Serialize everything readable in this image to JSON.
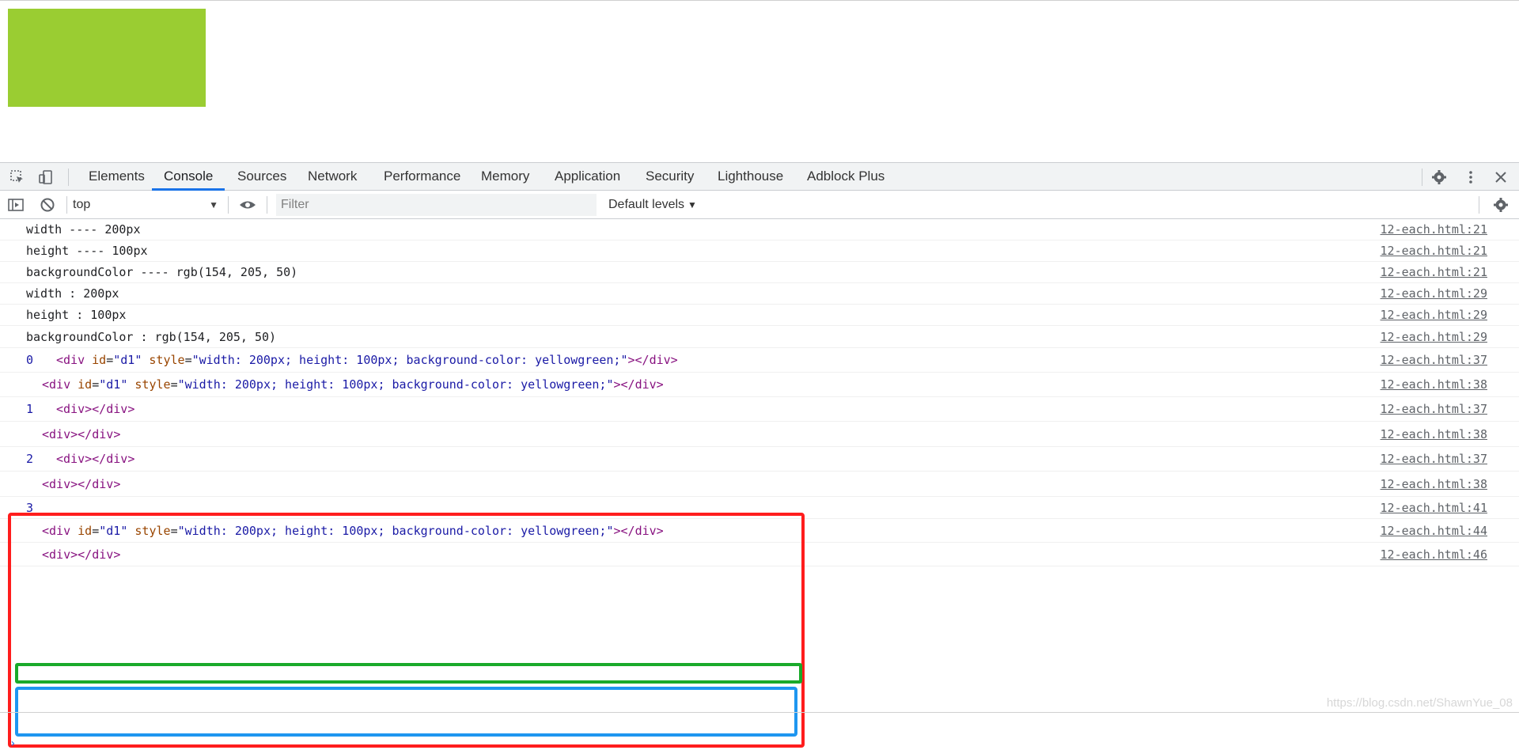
{
  "page": {
    "box_color": "#9acd32"
  },
  "devtools": {
    "tabs": [
      "Elements",
      "Console",
      "Sources",
      "Network",
      "Performance",
      "Memory",
      "Application",
      "Security",
      "Lighthouse",
      "Adblock Plus"
    ],
    "active_tab": "Console",
    "icons": [
      "inspect-element-icon",
      "device-toolbar-icon",
      "settings-gear-icon",
      "more-options-icon",
      "close-icon"
    ]
  },
  "console_bar": {
    "context": "top",
    "filter_placeholder": "Filter",
    "levels": "Default levels"
  },
  "logs": [
    {
      "msg": "width ---- 200px",
      "src": "12-each.html:21"
    },
    {
      "msg": "height ---- 100px",
      "src": "12-each.html:21"
    },
    {
      "msg": "backgroundColor ---- rgb(154, 205, 50)",
      "src": "12-each.html:21"
    },
    {
      "msg": "width : 200px",
      "src": "12-each.html:29"
    },
    {
      "msg": "height : 100px",
      "src": "12-each.html:29"
    },
    {
      "msg": "backgroundColor : rgb(154, 205, 50)",
      "src": "12-each.html:29"
    },
    {
      "index": "0",
      "html": "<div id=\"d1\" style=\"width: 200px; height: 100px; background-color: yellowgreen;\"></div>",
      "src": "12-each.html:37"
    },
    {
      "html": "<div id=\"d1\" style=\"width: 200px; height: 100px; background-color: yellowgreen;\"></div>",
      "src": "12-each.html:38"
    },
    {
      "index": "1",
      "html": "<div></div>",
      "src": "12-each.html:37"
    },
    {
      "html": "<div></div>",
      "src": "12-each.html:38"
    },
    {
      "index": "2",
      "html": "<div></div>",
      "src": "12-each.html:37"
    },
    {
      "html": "<div></div>",
      "src": "12-each.html:38"
    },
    {
      "index": "3",
      "src": "12-each.html:41"
    },
    {
      "html": "<div id=\"d1\" style=\"width: 200px; height: 100px; background-color: yellowgreen;\"></div>",
      "src": "12-each.html:44"
    },
    {
      "html": "<div></div>",
      "src": "12-each.html:46"
    }
  ],
  "annotations": {
    "red": "#ff1d1d",
    "green": "#1aaa2a",
    "blue": "#1e96f0"
  },
  "prompt": "›",
  "watermark": "https://blog.csdn.net/ShawnYue_08"
}
